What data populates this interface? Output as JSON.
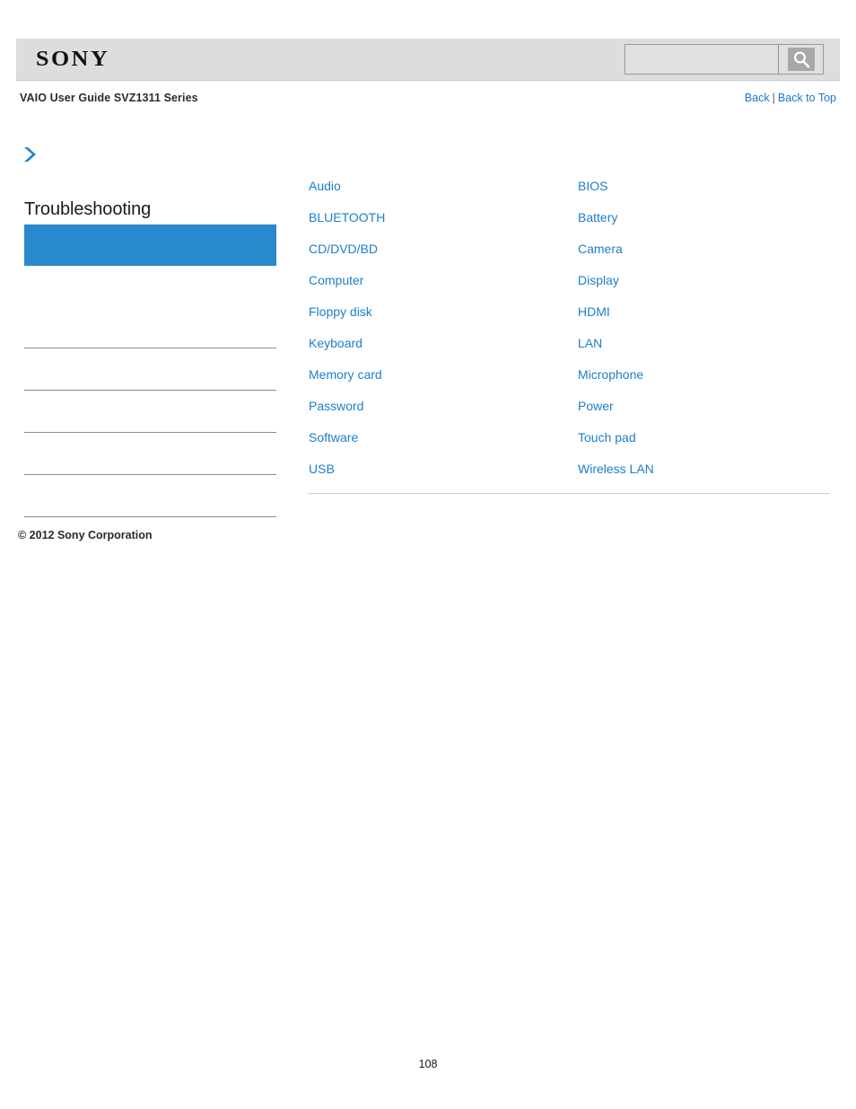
{
  "header": {
    "brand": "SONY",
    "search": {
      "value": "",
      "placeholder": "",
      "icon": "search-icon"
    }
  },
  "breadcrumb": {
    "doc_title": "VAIO User Guide SVZ1311 Series",
    "back_label": "Back",
    "separator": "|",
    "back_to_top_label": "Back to Top"
  },
  "sidebar": {
    "chevron_icon": "chevron-right-icon",
    "title": "Troubleshooting",
    "active_item_label": "",
    "items": [
      {
        "label": ""
      },
      {
        "label": ""
      },
      {
        "label": ""
      },
      {
        "label": ""
      },
      {
        "label": ""
      }
    ]
  },
  "main": {
    "columns": [
      {
        "links": [
          "Audio",
          "BLUETOOTH",
          "CD/DVD/BD",
          "Computer",
          "Floppy disk",
          "Keyboard",
          "Memory card",
          "Password",
          "Software",
          "USB"
        ]
      },
      {
        "links": [
          "BIOS",
          "Battery",
          "Camera",
          "Display",
          "HDMI",
          "LAN",
          "Microphone",
          "Power",
          "Touch pad",
          "Wireless LAN"
        ]
      }
    ]
  },
  "footer": {
    "copyright": "© 2012 Sony Corporation",
    "page_number": "108"
  },
  "colors": {
    "accent_blue": "#2889cc",
    "link_blue": "#1f7ec8",
    "header_gray": "#dddddd",
    "rule_gray": "#8c8c8c"
  }
}
